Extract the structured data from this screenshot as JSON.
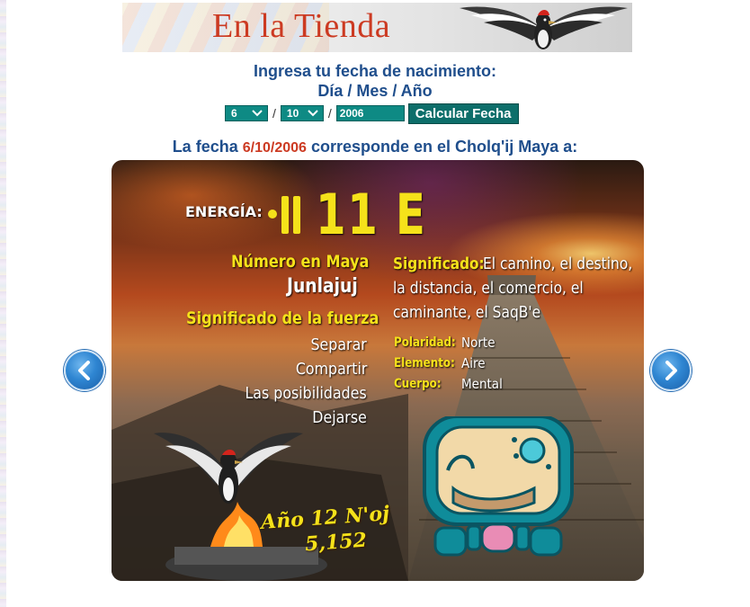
{
  "banner": {
    "title": "En la Tienda"
  },
  "form": {
    "prompt_line1": "Ingresa tu fecha de nacimiento:",
    "prompt_line2": "Día / Mes / Año",
    "day_value": "6",
    "month_value": "10",
    "year_value": "2006",
    "separator": "/",
    "submit_label": "Calcular Fecha"
  },
  "result": {
    "prefix": "La fecha",
    "date": "6/10/2006",
    "suffix": "corresponde en el Cholq'ij Maya a:"
  },
  "card": {
    "energy_label": "ENERGÍA:",
    "energy_value": "11 E",
    "numero_label": "Número en Maya",
    "numero_value": "Junlajuj",
    "fuerza_label": "Significado de la fuerza",
    "fuerza_items": [
      "Separar",
      "Compartir",
      "Las posibilidades",
      "Dejarse"
    ],
    "significado_label": "Significado:",
    "significado_lines": [
      "El camino, el destino,",
      "la distancia, el comercio, el",
      "caminante, el SaqB'e"
    ],
    "attributes": [
      {
        "label": "Polaridad:",
        "value": "Norte"
      },
      {
        "label": "Elemento:",
        "value": "Aire"
      },
      {
        "label": "Cuerpo:",
        "value": "Mental"
      }
    ],
    "year_label": "Año 12 N'oj",
    "year_number": "5,152"
  },
  "colors": {
    "heading_blue": "#1f4e8c",
    "accent_red": "#cc3a22",
    "teal": "#0e8a84",
    "highlight_yellow": "#f5e21a"
  },
  "icons": {
    "prev": "chevron-left-icon",
    "next": "chevron-right-icon"
  }
}
